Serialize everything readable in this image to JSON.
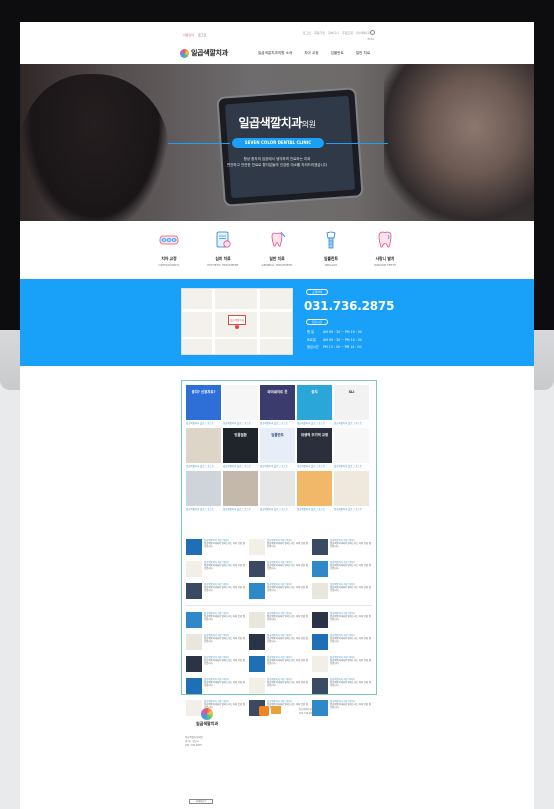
{
  "header": {
    "util_left": [
      "이용안내",
      "로그인"
    ],
    "util_right": [
      "로그인",
      "회원가입",
      "장바구니",
      "주문조회",
      "마이페이지"
    ],
    "util_kor": "ENG",
    "logo_text": "일곱색깔치과",
    "nav": [
      "일곱색깔치과의원 소개",
      "치아 교정",
      "임플란트",
      "일반 치료"
    ]
  },
  "hero": {
    "title": "일곱색깔치과",
    "title_suffix": "의원",
    "pill": "SEVEN COLOR DENTAL CLINIC",
    "desc_1": "항상 환자의 입장에서 생각하며 진료하는 치과",
    "desc_2": "편안하고 안전한 진료로 환자분들의 건강한 미소를 지켜드리겠습니다"
  },
  "services": [
    {
      "name": "치아 교정",
      "en": "ORTHODONTIC",
      "icon": "braces-icon"
    },
    {
      "name": "심미 치료",
      "en": "ESTHETIC TREATMENT",
      "icon": "clipboard-tooth-icon"
    },
    {
      "name": "일반 치료",
      "en": "GENERAL TREATMENT",
      "icon": "tooth-brush-icon"
    },
    {
      "name": "임플란트",
      "en": "IMPLANT",
      "icon": "implant-icon"
    },
    {
      "name": "사랑니 발치",
      "en": "WISDOM TEETH",
      "icon": "wisdom-tooth-icon"
    }
  ],
  "info": {
    "map_label": "일곱색깔치과",
    "tel_label": "고객센터",
    "tel": "031.736.2875",
    "hours_label": "진료시간",
    "hours": [
      {
        "day": "평  일",
        "time": "AM 09 : 30 ~ PM 19 : 00"
      },
      {
        "day": "토요일",
        "time": "AM 09 : 30 ~ PM 14 : 00"
      },
      {
        "day": "점심시간",
        "time": "PM 13 : 00 ~ PM 14 : 00"
      }
    ]
  },
  "blog": {
    "thumbs": [
      {
        "t": "충치? 신경치료?",
        "bg": "#2d6fd6",
        "fg": "#fff"
      },
      {
        "t": "",
        "bg": "#f6f6f6",
        "fg": "#333"
      },
      {
        "t": "라미네이트 뭇",
        "bg": "#3b3b6e",
        "fg": "#fff"
      },
      {
        "t": "충치",
        "bg": "#2aa6d8",
        "fg": "#fff"
      },
      {
        "t": "SLI",
        "bg": "#f2f2f2",
        "fg": "#333"
      },
      {
        "t": "",
        "bg": "#ded5c9",
        "fg": "#333"
      },
      {
        "t": "잇몸질환",
        "bg": "#20242b",
        "fg": "#fff"
      },
      {
        "t": "임플란트",
        "bg": "#e7eef7",
        "fg": "#1e3a6e"
      },
      {
        "t": "위생적 주기적 교정",
        "bg": "#2a2f3b",
        "fg": "#fff"
      },
      {
        "t": "",
        "bg": "#f7f7f7",
        "fg": "#333"
      },
      {
        "t": "",
        "bg": "#cfd4da",
        "fg": "#333"
      },
      {
        "t": "",
        "bg": "#c4b8aa",
        "fg": "#333"
      },
      {
        "t": "",
        "bg": "#e6e6e6",
        "fg": "#333"
      },
      {
        "t": "",
        "bg": "#f1b86a",
        "fg": "#333"
      },
      {
        "t": "",
        "bg": "#efe8dc",
        "fg": "#333"
      }
    ],
    "caption": "일곱색깔치과 블로그 포스트",
    "post_title": "일곱색깔치과 치료 이야기",
    "post_body": "일곱색깔치과에서 알려드리는 치아 건강 정보입니다."
  },
  "footer": {
    "logo_text": "일곱색깔치과",
    "info_lines": [
      "일곱색깔치과의원",
      "경기도 성남시",
      "031-736-2875"
    ],
    "button": "자세히보기"
  }
}
